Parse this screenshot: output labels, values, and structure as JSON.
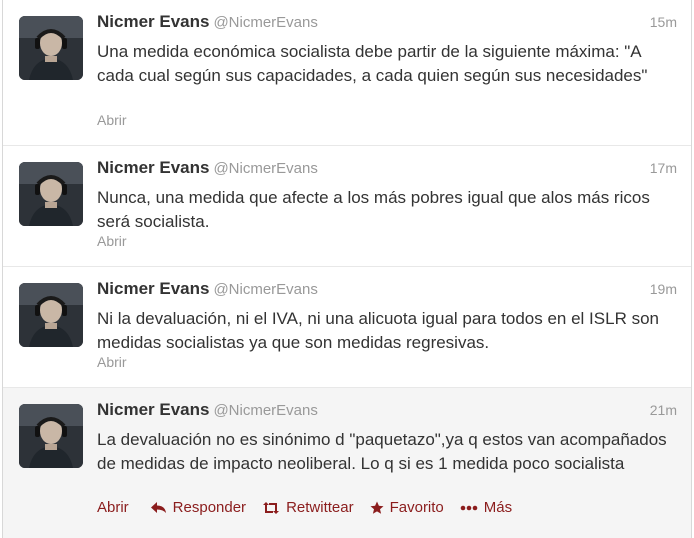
{
  "tweets": [
    {
      "name": "Nicmer Evans",
      "handle": "@NicmerEvans",
      "time": "15m",
      "text": "Una medida económica socialista debe partir de la siguiente máxima: \"A cada cual según sus capacidades, a cada quien según sus necesidades\"",
      "open_label": "Abrir"
    },
    {
      "name": "Nicmer Evans",
      "handle": "@NicmerEvans",
      "time": "17m",
      "text": "Nunca, una medida que afecte a los más pobres igual que alos más ricos será socialista.",
      "open_label": "Abrir"
    },
    {
      "name": "Nicmer Evans",
      "handle": "@NicmerEvans",
      "time": "19m",
      "text": "Ni la devaluación, ni el IVA, ni una alicuota igual para todos en el ISLR son medidas socialistas ya que son medidas regresivas.",
      "open_label": "Abrir"
    },
    {
      "name": "Nicmer Evans",
      "handle": "@NicmerEvans",
      "time": "21m",
      "text": "La devaluación no es sinónimo d \"paquetazo\",ya q estos van acompañados de medidas de impacto neoliberal. Lo q si es 1 medida poco socialista",
      "actions": {
        "open": "Abrir",
        "reply": "Responder",
        "retweet": "Retwittear",
        "favorite": "Favorito",
        "more": "Más"
      }
    }
  ],
  "colors": {
    "text": "#333333",
    "muted": "#999999",
    "action": "#8b1d1d",
    "hover_bg": "#f5f5f5"
  },
  "icons": [
    "avatar-photo",
    "reply-arrow-icon",
    "retweet-icon",
    "star-icon",
    "more-dots-icon"
  ]
}
